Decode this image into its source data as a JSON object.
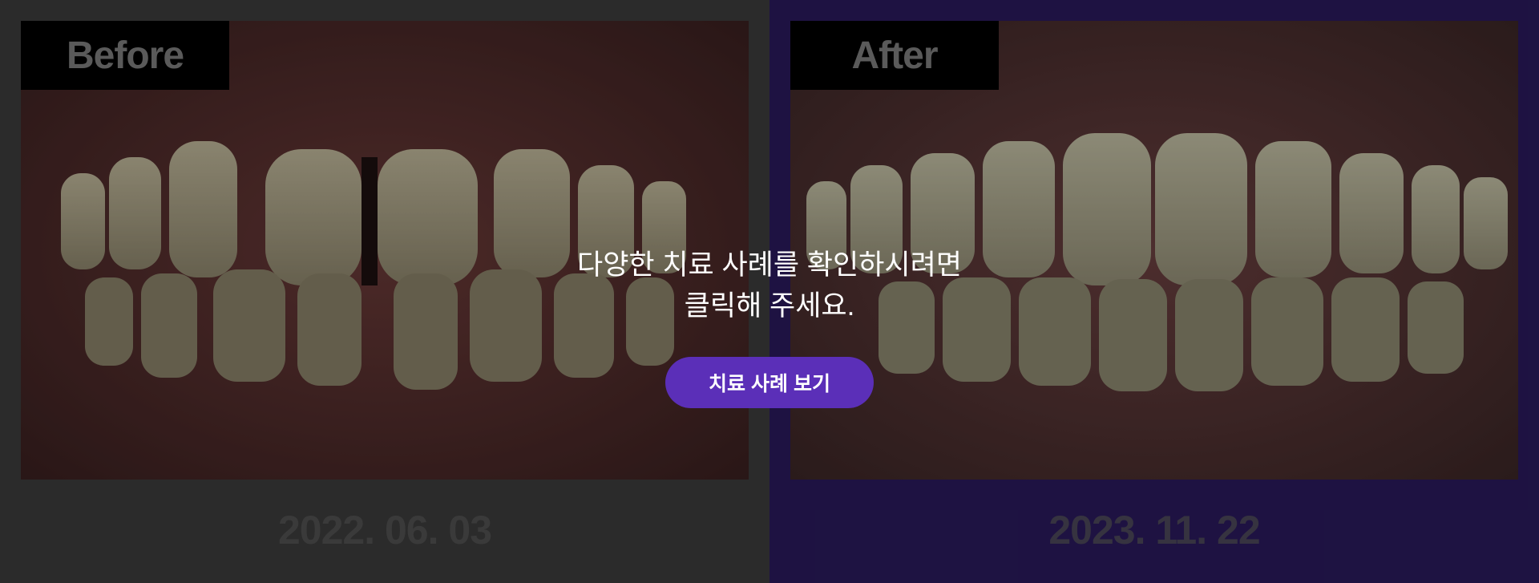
{
  "before": {
    "tag_label": "Before",
    "date": "2022. 06. 03"
  },
  "after": {
    "tag_label": "After",
    "date": "2023. 11. 22"
  },
  "overlay": {
    "message_line1": "다양한 치료 사례를 확인하시려면",
    "message_line2": "클릭해 주세요.",
    "button_label": "치료 사례 보기"
  },
  "colors": {
    "accent": "#5b2fb8",
    "before_panel_bg": "#3c3c3c",
    "after_panel_bg": "#2a1a5c"
  }
}
